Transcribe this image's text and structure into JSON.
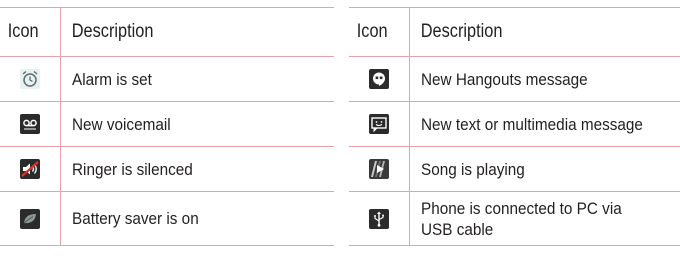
{
  "left_table": {
    "header": {
      "icon": "Icon",
      "description": "Description"
    },
    "rows": [
      {
        "icon": "alarm-clock-icon",
        "description": "Alarm is set"
      },
      {
        "icon": "voicemail-icon",
        "description": "New voicemail"
      },
      {
        "icon": "ringer-silenced-icon",
        "description": "Ringer is silenced"
      },
      {
        "icon": "battery-saver-leaf-icon",
        "description": "Battery saver is on"
      }
    ]
  },
  "right_table": {
    "header": {
      "icon": "Icon",
      "description": "Description"
    },
    "rows": [
      {
        "icon": "hangouts-icon",
        "description": "New Hangouts message"
      },
      {
        "icon": "text-message-icon",
        "description": "New text or multimedia message"
      },
      {
        "icon": "music-playing-icon",
        "description": "Song is playing"
      },
      {
        "icon": "usb-icon",
        "description_line1": "Phone is connected to PC via",
        "description_line2": "USB cable"
      }
    ]
  },
  "colors": {
    "rule": "#e6a3a7",
    "text": "#231f20",
    "icon_dark": "#2b2b2b",
    "icon_light": "#e8f0f0"
  }
}
